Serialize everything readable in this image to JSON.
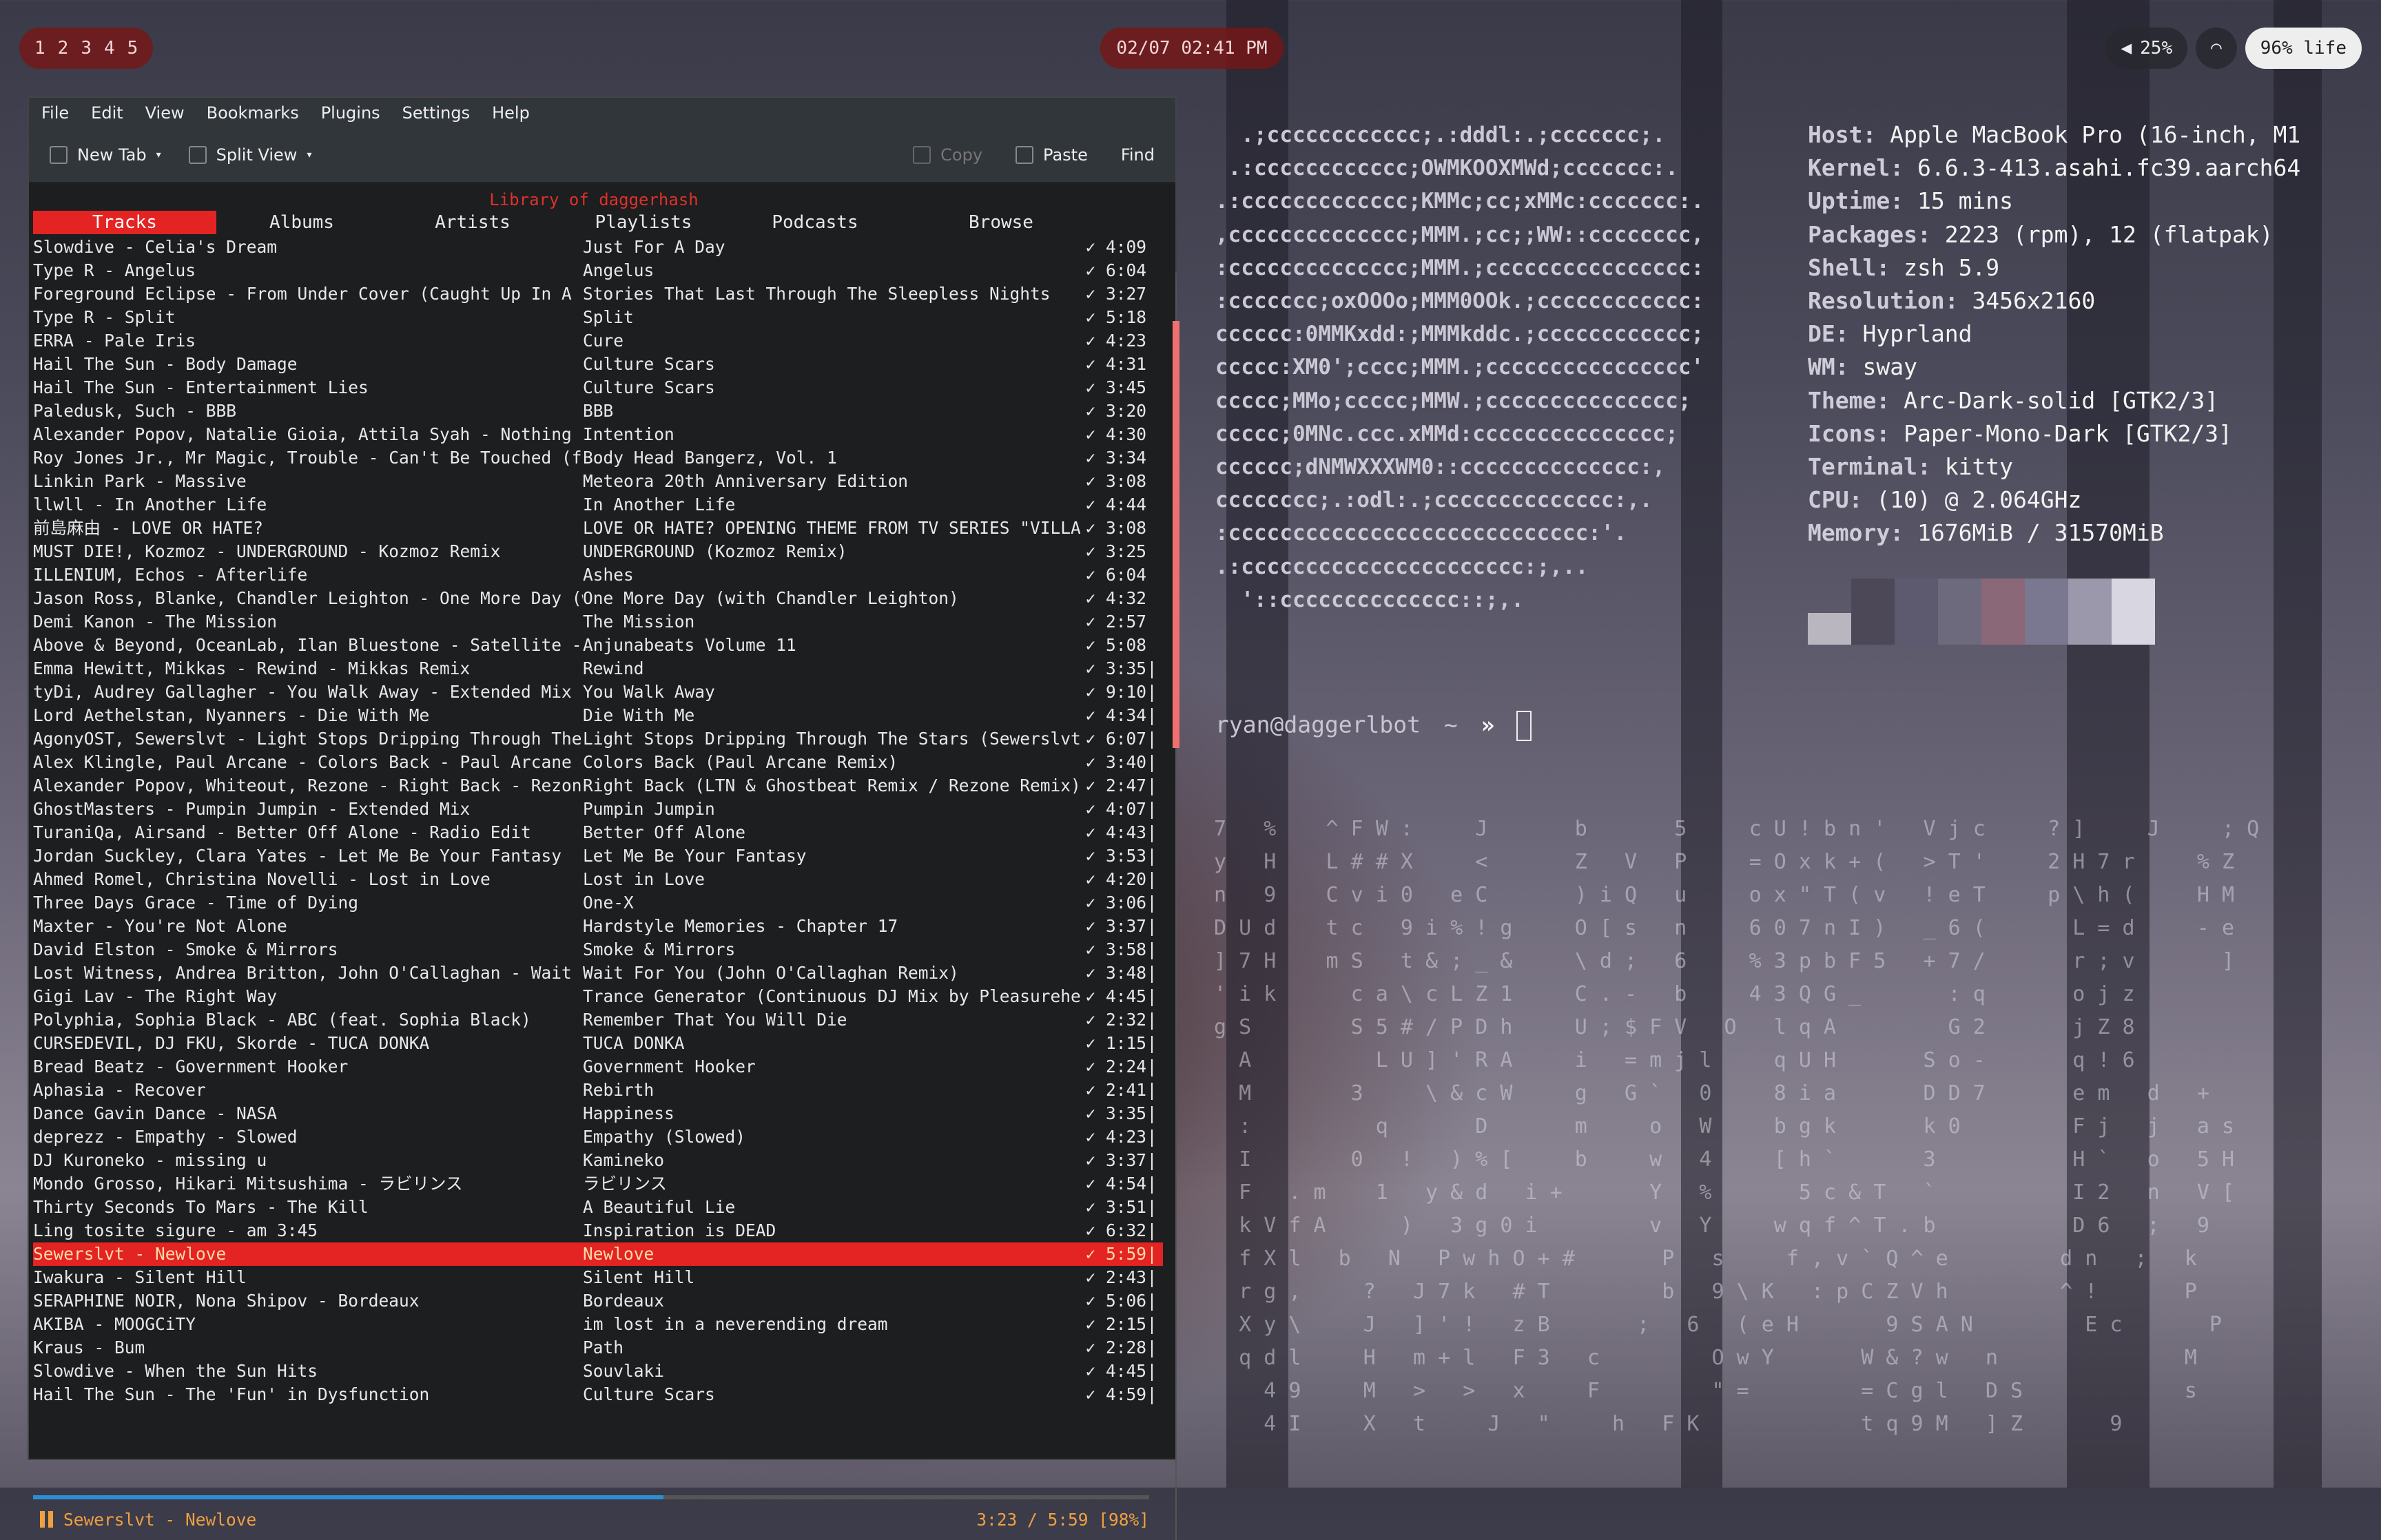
{
  "topbar": {
    "workspaces": [
      "1",
      "2",
      "3",
      "4",
      "5"
    ],
    "clock": "02/07 02:41 PM",
    "volume": "25%",
    "battery": "96% life"
  },
  "player": {
    "menu": [
      "File",
      "Edit",
      "View",
      "Bookmarks",
      "Plugins",
      "Settings",
      "Help"
    ],
    "toolbar": {
      "new_tab": "New Tab",
      "split_view": "Split View",
      "copy": "Copy",
      "paste": "Paste",
      "find": "Find"
    },
    "library_title": "Library of daggerhash",
    "tabs": [
      "Tracks",
      "Albums",
      "Artists",
      "Playlists",
      "Podcasts",
      "Browse"
    ],
    "active_tab": "Tracks",
    "tracks": [
      {
        "title": "Slowdive - Celia's Dream",
        "album": "Just For A Day",
        "dur": "4:09"
      },
      {
        "title": "Type R - Angelus",
        "album": "Angelus",
        "dur": "6:04"
      },
      {
        "title": "Foreground Eclipse - From Under Cover (Caught Up In A L..",
        "album": "Stories That Last Through The Sleepless Nights",
        "dur": "3:27"
      },
      {
        "title": "Type R - Split",
        "album": "Split",
        "dur": "5:18"
      },
      {
        "title": "ERRA - Pale Iris",
        "album": "Cure",
        "dur": "4:23"
      },
      {
        "title": "Hail The Sun - Body Damage",
        "album": "Culture Scars",
        "dur": "4:31"
      },
      {
        "title": "Hail The Sun - Entertainment Lies",
        "album": "Culture Scars",
        "dur": "3:45"
      },
      {
        "title": "Paledusk, Such - BBB",
        "album": "BBB",
        "dur": "3:20"
      },
      {
        "title": "Alexander Popov, Natalie Gioia, Attila Syah - Nothing I..",
        "album": "Intention",
        "dur": "4:30"
      },
      {
        "title": "Roy Jones Jr., Mr Magic, Trouble - Can't Be Touched (fe..",
        "album": "Body Head Bangerz, Vol. 1",
        "dur": "3:34"
      },
      {
        "title": "Linkin Park - Massive",
        "album": "Meteora 20th Anniversary Edition",
        "dur": "3:08"
      },
      {
        "title": "llwll - In Another Life",
        "album": "In Another Life",
        "dur": "4:44"
      },
      {
        "title": "前島麻由 - LOVE OR HATE?",
        "album": "LOVE OR HATE? OPENING THEME FROM TV SERIES \"VILLA..",
        "dur": "3:08"
      },
      {
        "title": "MUST DIE!, Kozmoz - UNDERGROUND - Kozmoz Remix",
        "album": "UNDERGROUND (Kozmoz Remix)",
        "dur": "3:25"
      },
      {
        "title": "ILLENIUM, Echos - Afterlife",
        "album": "Ashes",
        "dur": "6:04"
      },
      {
        "title": "Jason Ross, Blanke, Chandler Leighton - One More Day (w..",
        "album": "One More Day (with Chandler Leighton)",
        "dur": "4:32"
      },
      {
        "title": "Demi Kanon - The Mission",
        "album": "The Mission",
        "dur": "2:57"
      },
      {
        "title": "Above & Beyond, OceanLab, Ilan Bluestone - Satellite - ..",
        "album": "Anjunabeats Volume 11",
        "dur": "5:08"
      },
      {
        "title": "Emma Hewitt, Mikkas - Rewind - Mikkas Remix",
        "album": "Rewind",
        "dur": "3:35"
      },
      {
        "title": "tyDi, Audrey Gallagher - You Walk Away - Extended Mix",
        "album": "You Walk Away",
        "dur": "9:10"
      },
      {
        "title": "Lord Aethelstan, Nyanners - Die With Me",
        "album": "Die With Me",
        "dur": "4:34"
      },
      {
        "title": "AgonyOST, Sewerslvt - Light Stops Dripping Through The ..",
        "album": "Light Stops Dripping Through The Stars (Sewerslvt..",
        "dur": "6:07"
      },
      {
        "title": "Alex Klingle, Paul Arcane - Colors Back - Paul Arcane R..",
        "album": "Colors Back (Paul Arcane Remix)",
        "dur": "3:40"
      },
      {
        "title": "Alexander Popov, Whiteout, Rezone - Right Back - Rezone..",
        "album": "Right Back (LTN & Ghostbeat Remix / Rezone Remix)",
        "dur": "2:47"
      },
      {
        "title": "GhostMasters - Pumpin Jumpin - Extended Mix",
        "album": "Pumpin Jumpin",
        "dur": "4:07"
      },
      {
        "title": "TuraniQa, Airsand - Better Off Alone - Radio Edit",
        "album": "Better Off Alone",
        "dur": "4:43"
      },
      {
        "title": "Jordan Suckley, Clara Yates - Let Me Be Your Fantasy",
        "album": "Let Me Be Your Fantasy",
        "dur": "3:53"
      },
      {
        "title": "Ahmed Romel, Christina Novelli - Lost in Love",
        "album": "Lost in Love",
        "dur": "4:20"
      },
      {
        "title": "Three Days Grace - Time of Dying",
        "album": "One-X",
        "dur": "3:06"
      },
      {
        "title": "Maxter - You're Not Alone",
        "album": "Hardstyle Memories - Chapter 17",
        "dur": "3:37"
      },
      {
        "title": "David Elston - Smoke & Mirrors",
        "album": "Smoke & Mirrors",
        "dur": "3:58"
      },
      {
        "title": "Lost Witness, Andrea Britton, John O'Callaghan - Wait F..",
        "album": "Wait For You (John O'Callaghan Remix)",
        "dur": "3:48"
      },
      {
        "title": "Gigi Lav - The Right Way",
        "album": "Trance Generator (Continuous DJ Mix by Pleasurehe..",
        "dur": "4:45"
      },
      {
        "title": "Polyphia, Sophia Black - ABC (feat. Sophia Black)",
        "album": "Remember That You Will Die",
        "dur": "2:32"
      },
      {
        "title": "CURSEDEVIL, DJ FKU, Skorde - TUCA DONKA",
        "album": "TUCA DONKA",
        "dur": "1:15"
      },
      {
        "title": "Bread Beatz - Government Hooker",
        "album": "Government Hooker",
        "dur": "2:24"
      },
      {
        "title": "Aphasia - Recover",
        "album": "Rebirth",
        "dur": "2:41"
      },
      {
        "title": "Dance Gavin Dance - NASA",
        "album": "Happiness",
        "dur": "3:35"
      },
      {
        "title": "deprezz - Empathy - Slowed",
        "album": "Empathy (Slowed)",
        "dur": "4:23"
      },
      {
        "title": "DJ Kuroneko - missing u",
        "album": "Kamineko",
        "dur": "3:37"
      },
      {
        "title": "Mondo Grosso, Hikari Mitsushima - ラビリンス",
        "album": "ラビリンス",
        "dur": "4:54"
      },
      {
        "title": "Thirty Seconds To Mars - The Kill",
        "album": "A Beautiful Lie",
        "dur": "3:51"
      },
      {
        "title": "Ling tosite sigure - am 3:45",
        "album": "Inspiration is DEAD",
        "dur": "6:32"
      },
      {
        "title": "Sewerslvt - Newlove",
        "album": "Newlove",
        "dur": "5:59",
        "playing": true
      },
      {
        "title": "Iwakura - Silent Hill",
        "album": "Silent Hill",
        "dur": "2:43"
      },
      {
        "title": "SERAPHINE NOIR, Nona Shipov - Bordeaux",
        "album": "Bordeaux",
        "dur": "5:06"
      },
      {
        "title": "AKIBA - MOOGCiTY",
        "album": "im lost in a neverending dream",
        "dur": "2:15"
      },
      {
        "title": "Kraus - Bum",
        "album": "Path",
        "dur": "2:28"
      },
      {
        "title": "Slowdive - When the Sun Hits",
        "album": "Souvlaki",
        "dur": "4:45"
      },
      {
        "title": "Hail The Sun - The 'Fun' in Dysfunction",
        "album": "Culture Scars",
        "dur": "4:59"
      }
    ],
    "now_playing": "Sewerslvt - Newlove",
    "position": "3:23 / 5:59 [98%]",
    "progress": 0.565
  },
  "fetch": {
    "ascii": [
      "  .;cccccccccccc;.:dddl:.;ccccccc;.",
      " .:cccccccccccc;OWMKOOXMWd;ccccccc:.",
      ".:ccccccccccccc;KMMc;cc;xMMc:ccccccc:.",
      ",cccccccccccccc;MMM.;cc;;WW::cccccccc,",
      ":cccccccccccccc;MMM.;cccccccccccccccc:",
      ":ccccccc;oxOOOo;MMM0OOk.;cccccccccccc:",
      "cccccc:0MMKxdd:;MMMkddc.;cccccccccccc;",
      "ccccc:XM0';cccc;MMM.;cccccccccccccccc'",
      "ccccc;MMo;ccccc;MMW.;ccccccccccccccc;",
      "ccccc;0MNc.ccc.xMMd:ccccccccccccccc;",
      "cccccc;dNMWXXXWM0::cccccccccccccc:,",
      "cccccccc;.:odl:.;cccccccccccccc:,.",
      ":cccccccccccccccccccccccccccc:'.",
      ".:cccccccccccccccccccccc:;,..",
      "  '::cccccccccccccc::;,."
    ],
    "info": [
      {
        "k": "Host",
        "v": "Apple MacBook Pro (16-inch, M1"
      },
      {
        "k": "Kernel",
        "v": "6.6.3-413.asahi.fc39.aarch64"
      },
      {
        "k": "Uptime",
        "v": "15 mins"
      },
      {
        "k": "Packages",
        "v": "2223 (rpm), 12 (flatpak)"
      },
      {
        "k": "Shell",
        "v": "zsh 5.9"
      },
      {
        "k": "Resolution",
        "v": "3456x2160"
      },
      {
        "k": "DE",
        "v": "Hyprland"
      },
      {
        "k": "WM",
        "v": "sway"
      },
      {
        "k": "Theme",
        "v": "Arc-Dark-solid [GTK2/3]"
      },
      {
        "k": "Icons",
        "v": "Paper-Mono-Dark [GTK2/3]"
      },
      {
        "k": "Terminal",
        "v": "kitty"
      },
      {
        "k": "CPU",
        "v": "(10) @ 2.064GHz"
      },
      {
        "k": "Memory",
        "v": "1676MiB / 31570MiB"
      }
    ],
    "palette": [
      "#b9b6c0",
      "#4c4858",
      "#5d5a70",
      "#6e6a7d",
      "#8a6878",
      "#7a7890",
      "#9c98ac",
      "#d8d6e0"
    ],
    "prompt_user": "ryan@daggerlbot",
    "prompt_path": "~",
    "prompt_symbol": "»"
  },
  "matrix": [
    "7   %    ^ F W :     J       b       5     c U ! b n '   V j c     ? ]     J     ; Q",
    "y   H    L # # X     <       Z   V   P     = O x k + (   > T '     2 H 7 r     % Z",
    "n   9    C v i 0   e C       ) i Q   u     o x \" T ( v   ! e T     p \\ h (     H M",
    "D U d    t c   9 i % ! g     O [ s   n     6 0 7 n I )   _ 6 (       L = d     - e",
    "] 7 H    m S   t & ; _ &     \\ d ;   6     % 3 p b F 5   + 7 /       r ; v       ]",
    "' i k      c a \\ c L Z 1     C . -   b     4 3 Q G _       : q       o j z",
    "g S        S 5 # / P D h     U ; $ F V   O   l q A         G 2       j Z 8",
    "  A          L U ] ' R A     i   = m j l     q U H       S o -       q ! 6",
    "  M        3     \\ & c W     g   G `   0     8 i a       D D 7       e m   d   +",
    "  :          q       D       m     o   W     b g k       k 0         F j   j   a s",
    "  I        0   !   ) % [     b     w   4     [ h `       3           H `   o   5 H",
    "  F   . m    1   y & d   i +       Y   %       5 c & T   `           I 2   n   V [",
    "  k V f A      )   3 g 0 i         v   Y     w q f ^ T . b           D 6   ;   9",
    "  f X l   b   N   P w h O + #       P   s     f , v ` Q ^ e         d n   ;   k",
    "  r g ,     ?   J 7 k   # T         b   9 \\ K   : p C Z V h         ^ !       P",
    "  X y \\     J   ] ' !   z B       ;   6   ( e H       9 S A N         E c       P",
    "  q d l     H   m + l   F 3   c         O w Y       W & ? w   n               M",
    "    4 9     M   >   >   x     F         \" =         = C g l   D S             s",
    "    4 I     X   t     J   \"     h   F K             t q 9 M   ] Z       9"
  ]
}
